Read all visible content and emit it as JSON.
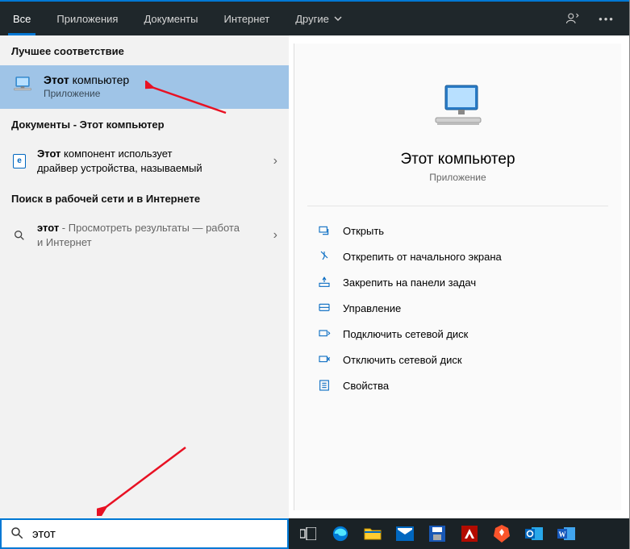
{
  "tabs": {
    "all": "Все",
    "apps": "Приложения",
    "docs": "Документы",
    "web": "Интернет",
    "more": "Другие"
  },
  "sections": {
    "best_match": "Лучшее соответствие",
    "documents_prefix": "Документы - Этот компьютер",
    "web_search": "Поиск в рабочей сети и в Интернете"
  },
  "best": {
    "title_bold": "Этот",
    "title_rest": " компьютер",
    "subtitle": "Приложение"
  },
  "doc_result": {
    "bold": "Этот",
    "line1_rest": " компонент использует",
    "line2": "драйвер устройства, называемый"
  },
  "web_result": {
    "bold": "этот",
    "rest": " - Просмотреть результаты — работа и Интернет"
  },
  "preview": {
    "title": "Этот компьютер",
    "subtitle": "Приложение"
  },
  "actions": {
    "open": "Открыть",
    "unpin_start": "Открепить от начального экрана",
    "pin_taskbar": "Закрепить на панели задач",
    "manage": "Управление",
    "map_drive": "Подключить сетевой диск",
    "unmap_drive": "Отключить сетевой диск",
    "properties": "Свойства"
  },
  "search": {
    "value": "этот"
  }
}
